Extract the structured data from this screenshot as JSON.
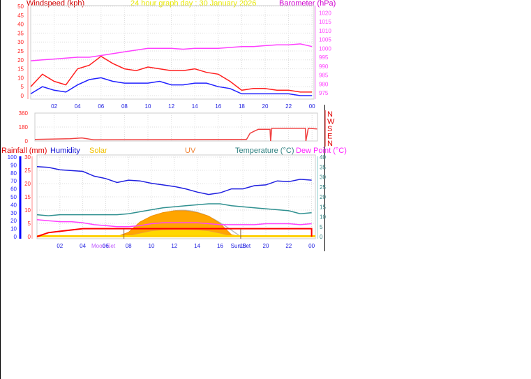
{
  "title": "24 hour graph day : 30 January 2026",
  "colors": {
    "wind_gust": "#ff2020",
    "wind_avg": "#2020ff",
    "barometer": "#ff40ff",
    "wind_dir": "#f04040",
    "humidity": "#2020e0",
    "temperature": "#2f9090",
    "dew_point": "#ff40ff",
    "rainfall": "#ff0000",
    "solar": "#ffd000",
    "uv": "#ff8000",
    "axis_hours": "#2020e0"
  },
  "hour_ticks": [
    "02",
    "04",
    "06",
    "08",
    "10",
    "12",
    "14",
    "16",
    "18",
    "20",
    "22",
    "00"
  ],
  "chart_data": [
    {
      "type": "line",
      "title": "24 hour graph day : 30 January 2026",
      "ylabel": "Windspeed (kph)",
      "y2label": "Barometer (hPa)",
      "ylim": [
        0,
        50
      ],
      "y2lim": [
        972,
        1023
      ],
      "yticks": [
        0,
        5,
        10,
        15,
        20,
        25,
        30,
        35,
        40,
        45,
        50
      ],
      "y2ticks": [
        975,
        980,
        985,
        990,
        995,
        1000,
        1005,
        1010,
        1015,
        1020
      ],
      "grid": true,
      "x": [
        0,
        1,
        2,
        3,
        4,
        5,
        6,
        7,
        8,
        9,
        10,
        11,
        12,
        13,
        14,
        15,
        16,
        17,
        18,
        19,
        20,
        21,
        22,
        23,
        24
      ],
      "series": [
        {
          "name": "Windspeed gust",
          "axis": "left",
          "values": [
            5,
            12,
            8,
            6,
            15,
            17,
            22,
            18,
            15,
            14,
            16,
            15,
            14,
            14,
            15,
            13,
            12,
            8,
            3,
            4,
            4,
            3,
            3,
            2,
            2
          ]
        },
        {
          "name": "Windspeed average",
          "axis": "left",
          "values": [
            1,
            5,
            3,
            2,
            6,
            9,
            10,
            8,
            7,
            7,
            7,
            8,
            6,
            6,
            7,
            7,
            5,
            4,
            1,
            1,
            1,
            1,
            1,
            0,
            0
          ]
        },
        {
          "name": "Barometer",
          "axis": "right",
          "values": [
            993,
            993.5,
            994,
            994.5,
            995,
            995,
            996,
            997,
            998,
            999,
            1000,
            1000,
            1000,
            999.5,
            1000,
            1000,
            1000,
            1000.5,
            1001,
            1001,
            1001.5,
            1002,
            1002,
            1002.5,
            1001
          ]
        }
      ]
    },
    {
      "type": "line",
      "yticks": [
        0,
        180,
        360
      ],
      "ylim": [
        0,
        360
      ],
      "compass": [
        "N",
        "W",
        "S",
        "E",
        "N"
      ],
      "grid": true,
      "x": [
        0,
        3,
        4,
        5,
        17,
        18,
        18.3,
        18.7,
        19,
        20,
        20.05,
        20.15,
        23,
        23.05,
        23.25,
        24
      ],
      "series": [
        {
          "name": "Wind direction",
          "values": [
            20,
            30,
            40,
            15,
            20,
            20,
            100,
            130,
            150,
            150,
            0,
            165,
            165,
            0,
            165,
            155
          ]
        }
      ]
    },
    {
      "type": "line",
      "legend": [
        "Rainfall (mm)",
        "Humidity",
        "Solar",
        "UV",
        "Temperature (°C)",
        "Dew Point (°C)"
      ],
      "legend_placement": "top",
      "grid": true,
      "humidity_ticks": [
        0,
        10,
        20,
        30,
        40,
        50,
        60,
        70,
        80,
        90,
        100
      ],
      "rain_ticks": [
        0,
        5,
        10,
        15,
        20,
        25,
        30
      ],
      "temp_ticks": [
        0,
        5,
        10,
        15,
        20,
        25,
        30,
        35,
        40
      ],
      "ylim_humidity": [
        0,
        100
      ],
      "ylim_rain": [
        0,
        30
      ],
      "ylim_temp": [
        0,
        40
      ],
      "x": [
        0,
        1,
        2,
        3,
        4,
        5,
        6,
        7,
        8,
        9,
        10,
        11,
        12,
        13,
        14,
        15,
        16,
        17,
        18,
        19,
        20,
        21,
        22,
        23,
        24
      ],
      "series": [
        {
          "name": "Humidity",
          "axis": "humidity",
          "values": [
            88,
            87,
            84,
            83,
            82,
            76,
            73,
            68,
            71,
            70,
            67,
            65,
            63,
            60,
            56,
            53,
            55,
            60,
            60,
            64,
            65,
            70,
            69,
            72,
            71
          ]
        },
        {
          "name": "Temperature (°C)",
          "axis": "temp",
          "values": [
            11,
            10.5,
            11,
            11,
            11,
            11,
            11,
            11,
            11.5,
            12.5,
            13.5,
            14.5,
            15,
            15.5,
            16,
            16.5,
            16.5,
            15.5,
            15,
            14.5,
            14,
            13.5,
            13,
            11.5,
            12
          ]
        },
        {
          "name": "Dew Point (°C)",
          "axis": "temp",
          "values": [
            8.5,
            8,
            7.5,
            7.5,
            7,
            6,
            5.5,
            5,
            5,
            5.5,
            6.5,
            7,
            7,
            7,
            7,
            6.5,
            6,
            6,
            6,
            6,
            6.5,
            6.5,
            6.5,
            6,
            6.5
          ]
        },
        {
          "name": "Rainfall (mm)",
          "axis": "rain",
          "values": [
            0,
            1.5,
            2,
            2.5,
            3,
            3,
            3,
            3,
            3,
            3,
            3,
            3,
            3,
            3,
            3,
            3,
            3,
            3,
            3,
            3,
            3,
            3,
            3,
            3,
            3
          ]
        },
        {
          "name": "Solar",
          "axis": "solar",
          "values": [
            0,
            0,
            0,
            0,
            0,
            0,
            0,
            0,
            150,
            500,
            700,
            820,
            880,
            880,
            820,
            700,
            450,
            60,
            0,
            0,
            0,
            0,
            0,
            0,
            0
          ]
        },
        {
          "name": "UV",
          "axis": "solar",
          "values": [
            0,
            0,
            0,
            0,
            0,
            0,
            0,
            0,
            30,
            120,
            200,
            230,
            240,
            240,
            230,
            200,
            120,
            20,
            0,
            0,
            0,
            0,
            0,
            0,
            0
          ]
        }
      ],
      "markers": [
        {
          "label": "Moon Set",
          "hour": 5.8
        },
        {
          "label": "Sun Rise",
          "hour": 7.6
        },
        {
          "label": "Sun Set",
          "hour": 17.8
        }
      ]
    }
  ]
}
